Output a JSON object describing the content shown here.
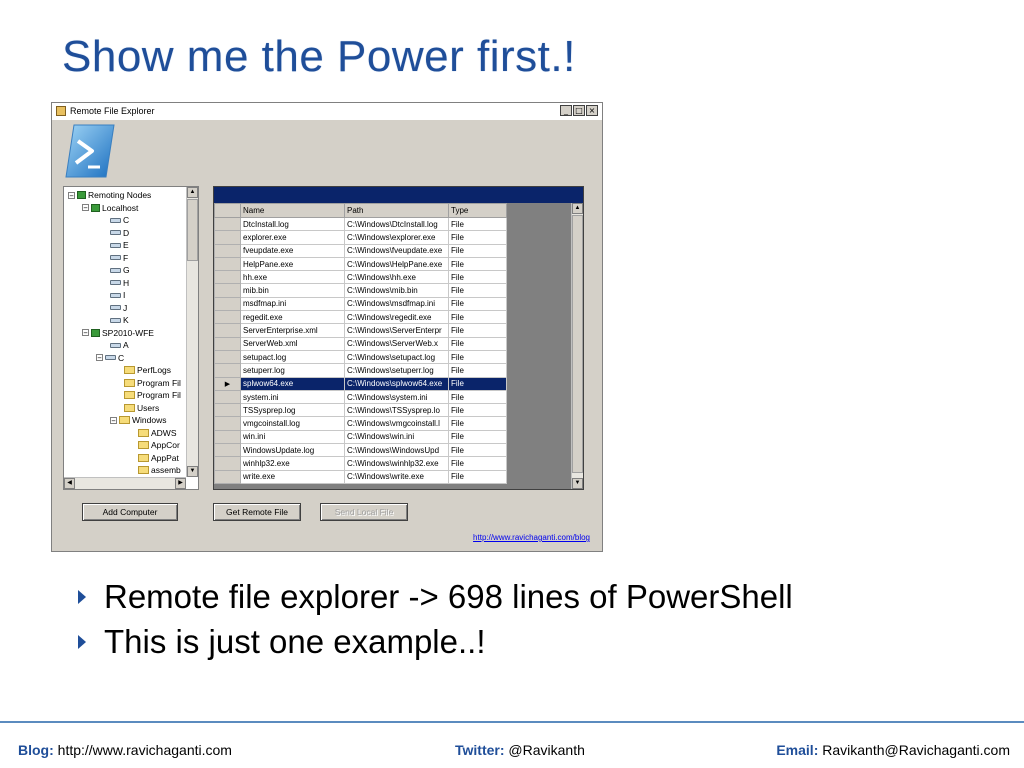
{
  "slide": {
    "title": "Show me the Power first.!",
    "bullets": [
      "Remote file explorer -> 698 lines of PowerShell",
      "This is just one example..!"
    ]
  },
  "window": {
    "title": "Remote File Explorer",
    "controls": {
      "minimize": "_",
      "maximize": "□",
      "close": "×"
    }
  },
  "tree": {
    "root": "Remoting Nodes",
    "localhost": "Localhost",
    "localhost_drives": [
      "C",
      "D",
      "E",
      "F",
      "G",
      "H",
      "I",
      "J",
      "K"
    ],
    "server": "SP2010-WFE",
    "server_drives": [
      "A",
      "C"
    ],
    "folders": [
      "PerfLogs",
      "Program Fil",
      "Program Fil",
      "Users",
      "Windows"
    ],
    "windows_children": [
      "ADWS",
      "AppCor",
      "AppPat",
      "assemb"
    ]
  },
  "grid": {
    "columns": [
      "Name",
      "Path",
      "Type"
    ],
    "rows": [
      [
        "DtcInstall.log",
        "C:\\Windows\\DtcInstall.log",
        "File"
      ],
      [
        "explorer.exe",
        "C:\\Windows\\explorer.exe",
        "File"
      ],
      [
        "fveupdate.exe",
        "C:\\Windows\\fveupdate.exe",
        "File"
      ],
      [
        "HelpPane.exe",
        "C:\\Windows\\HelpPane.exe",
        "File"
      ],
      [
        "hh.exe",
        "C:\\Windows\\hh.exe",
        "File"
      ],
      [
        "mib.bin",
        "C:\\Windows\\mib.bin",
        "File"
      ],
      [
        "msdfmap.ini",
        "C:\\Windows\\msdfmap.ini",
        "File"
      ],
      [
        "regedit.exe",
        "C:\\Windows\\regedit.exe",
        "File"
      ],
      [
        "ServerEnterprise.xml",
        "C:\\Windows\\ServerEnterpr",
        "File"
      ],
      [
        "ServerWeb.xml",
        "C:\\Windows\\ServerWeb.x",
        "File"
      ],
      [
        "setupact.log",
        "C:\\Windows\\setupact.log",
        "File"
      ],
      [
        "setuperr.log",
        "C:\\Windows\\setuperr.log",
        "File"
      ],
      [
        "splwow64.exe",
        "C:\\Windows\\splwow64.exe",
        "File"
      ],
      [
        "system.ini",
        "C:\\Windows\\system.ini",
        "File"
      ],
      [
        "TSSysprep.log",
        "C:\\Windows\\TSSysprep.lo",
        "File"
      ],
      [
        "vmgcoinstall.log",
        "C:\\Windows\\vmgcoinstall.l",
        "File"
      ],
      [
        "win.ini",
        "C:\\Windows\\win.ini",
        "File"
      ],
      [
        "WindowsUpdate.log",
        "C:\\Windows\\WindowsUpd",
        "File"
      ],
      [
        "winhlp32.exe",
        "C:\\Windows\\winhlp32.exe",
        "File"
      ],
      [
        "write.exe",
        "C:\\Windows\\write.exe",
        "File"
      ]
    ],
    "selected_row": 12,
    "row_indicator": "▶"
  },
  "buttons": {
    "add_computer": "Add Computer",
    "get_remote_file": "Get Remote File",
    "send_local_file": "Send Local File"
  },
  "blog_link": "http://www.ravichaganti.com/blog",
  "footer": {
    "blog_label": "Blog:",
    "blog_value": "http://www.ravichaganti.com",
    "twitter_label": "Twitter:",
    "twitter_value": "@Ravikanth",
    "email_label": "Email:",
    "email_value": "Ravikanth@Ravichaganti.com"
  }
}
